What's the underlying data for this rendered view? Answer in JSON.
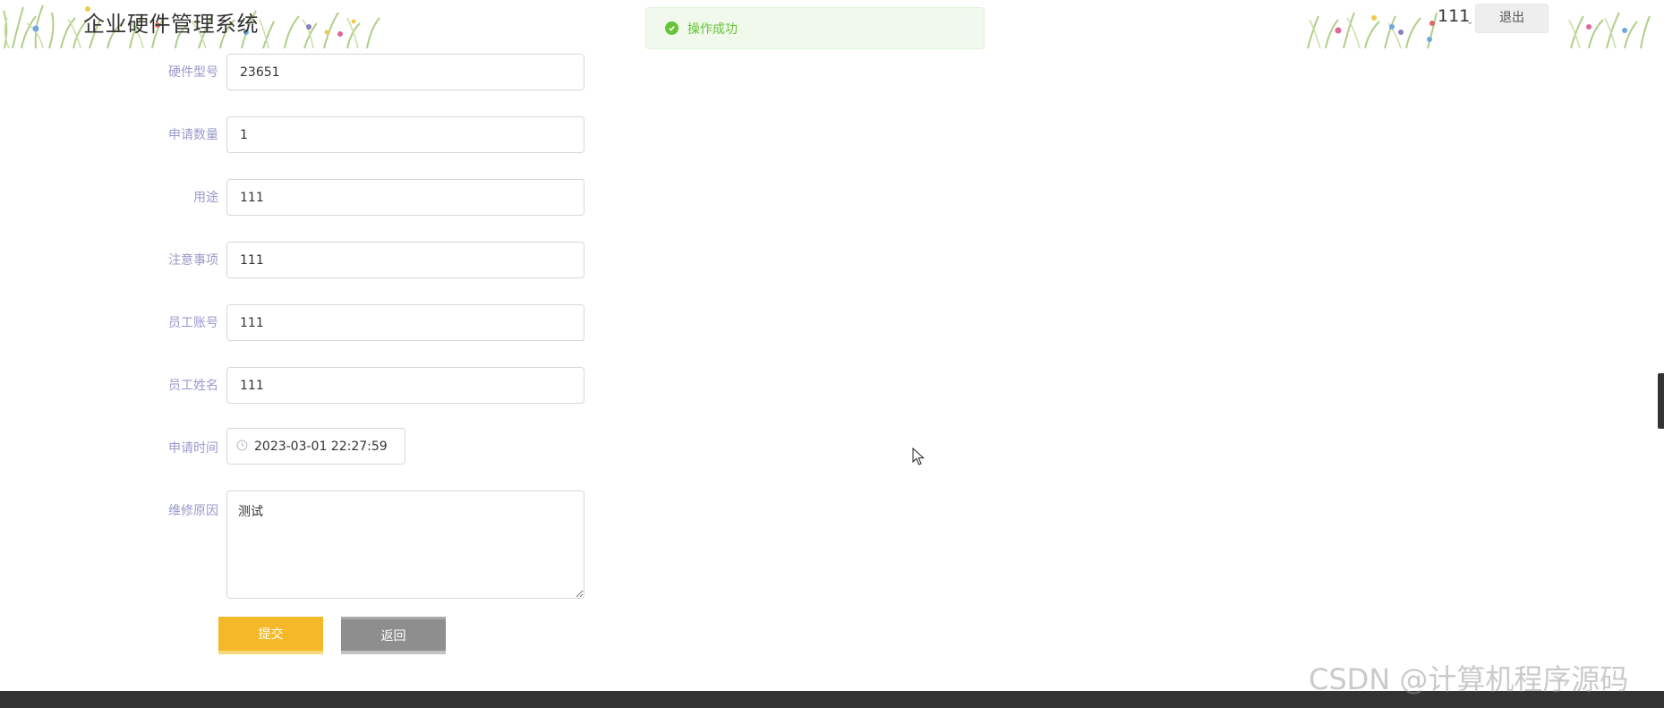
{
  "header": {
    "app_title": "企业硬件管理系统",
    "user_name": "111",
    "logout_label": "退出"
  },
  "toast": {
    "message": "操作成功",
    "icon": "check-circle-icon",
    "color": "#67c23a"
  },
  "form": {
    "fields": [
      {
        "label": "硬件型号",
        "value": "23651"
      },
      {
        "label": "申请数量",
        "value": "1"
      },
      {
        "label": "用途",
        "value": "111"
      },
      {
        "label": "注意事项",
        "value": "111"
      },
      {
        "label": "员工账号",
        "value": "111"
      },
      {
        "label": "员工姓名",
        "value": "111"
      }
    ],
    "apply_time": {
      "label": "申请时间",
      "value": "2023-03-01 22:27:59",
      "icon": "clock-icon"
    },
    "repair_reason": {
      "label": "维修原因",
      "value": "测试"
    },
    "submit_label": "提交",
    "back_label": "返回"
  },
  "watermark": "CSDN @计算机程序源码",
  "colors": {
    "submit": "#f5b828",
    "back": "#8e8e8e",
    "label": "#9999cc",
    "footer": "#333333"
  }
}
